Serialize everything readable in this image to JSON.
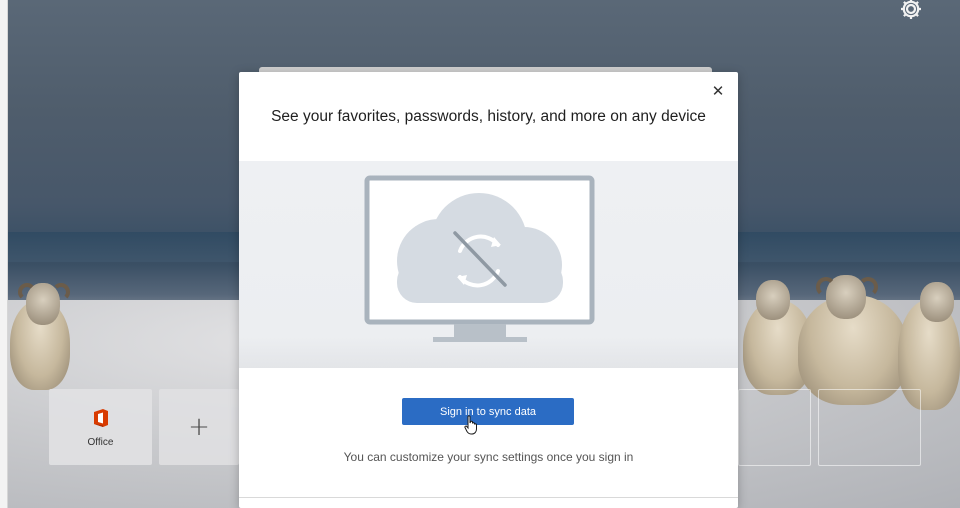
{
  "dialog": {
    "title": "See your favorites, passwords, history, and more on any device",
    "close_glyph": "✕",
    "close_icon": "close-icon",
    "sign_in_label": "Sign in to sync data",
    "helper_text": "You can customize your sync settings once you sign in",
    "illustration_icon": "monitor-cloud-sync-off-icon",
    "accent_color": "#2b6cc4"
  },
  "top_sites": {
    "tiles": [
      {
        "label": "Office",
        "icon": "office-icon"
      },
      {
        "label": "",
        "icon": "plus-icon"
      }
    ],
    "add_glyph": "+"
  },
  "page": {
    "settings_icon": "gear-icon",
    "background": "sheep-in-snow-photo"
  }
}
